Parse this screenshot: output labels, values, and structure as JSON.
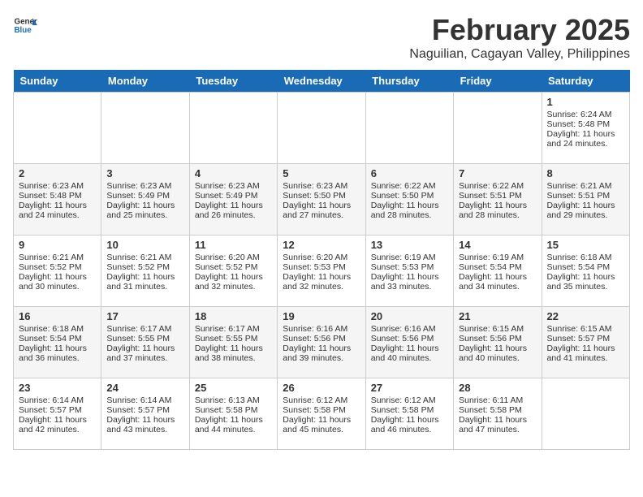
{
  "header": {
    "logo_general": "General",
    "logo_blue": "Blue",
    "month": "February 2025",
    "location": "Naguilian, Cagayan Valley, Philippines"
  },
  "weekdays": [
    "Sunday",
    "Monday",
    "Tuesday",
    "Wednesday",
    "Thursday",
    "Friday",
    "Saturday"
  ],
  "weeks": [
    [
      {
        "day": "",
        "info": ""
      },
      {
        "day": "",
        "info": ""
      },
      {
        "day": "",
        "info": ""
      },
      {
        "day": "",
        "info": ""
      },
      {
        "day": "",
        "info": ""
      },
      {
        "day": "",
        "info": ""
      },
      {
        "day": "1",
        "info": "Sunrise: 6:24 AM\nSunset: 5:48 PM\nDaylight: 11 hours and 24 minutes."
      }
    ],
    [
      {
        "day": "2",
        "info": "Sunrise: 6:23 AM\nSunset: 5:48 PM\nDaylight: 11 hours and 24 minutes."
      },
      {
        "day": "3",
        "info": "Sunrise: 6:23 AM\nSunset: 5:49 PM\nDaylight: 11 hours and 25 minutes."
      },
      {
        "day": "4",
        "info": "Sunrise: 6:23 AM\nSunset: 5:49 PM\nDaylight: 11 hours and 26 minutes."
      },
      {
        "day": "5",
        "info": "Sunrise: 6:23 AM\nSunset: 5:50 PM\nDaylight: 11 hours and 27 minutes."
      },
      {
        "day": "6",
        "info": "Sunrise: 6:22 AM\nSunset: 5:50 PM\nDaylight: 11 hours and 28 minutes."
      },
      {
        "day": "7",
        "info": "Sunrise: 6:22 AM\nSunset: 5:51 PM\nDaylight: 11 hours and 28 minutes."
      },
      {
        "day": "8",
        "info": "Sunrise: 6:21 AM\nSunset: 5:51 PM\nDaylight: 11 hours and 29 minutes."
      }
    ],
    [
      {
        "day": "9",
        "info": "Sunrise: 6:21 AM\nSunset: 5:52 PM\nDaylight: 11 hours and 30 minutes."
      },
      {
        "day": "10",
        "info": "Sunrise: 6:21 AM\nSunset: 5:52 PM\nDaylight: 11 hours and 31 minutes."
      },
      {
        "day": "11",
        "info": "Sunrise: 6:20 AM\nSunset: 5:52 PM\nDaylight: 11 hours and 32 minutes."
      },
      {
        "day": "12",
        "info": "Sunrise: 6:20 AM\nSunset: 5:53 PM\nDaylight: 11 hours and 32 minutes."
      },
      {
        "day": "13",
        "info": "Sunrise: 6:19 AM\nSunset: 5:53 PM\nDaylight: 11 hours and 33 minutes."
      },
      {
        "day": "14",
        "info": "Sunrise: 6:19 AM\nSunset: 5:54 PM\nDaylight: 11 hours and 34 minutes."
      },
      {
        "day": "15",
        "info": "Sunrise: 6:18 AM\nSunset: 5:54 PM\nDaylight: 11 hours and 35 minutes."
      }
    ],
    [
      {
        "day": "16",
        "info": "Sunrise: 6:18 AM\nSunset: 5:54 PM\nDaylight: 11 hours and 36 minutes."
      },
      {
        "day": "17",
        "info": "Sunrise: 6:17 AM\nSunset: 5:55 PM\nDaylight: 11 hours and 37 minutes."
      },
      {
        "day": "18",
        "info": "Sunrise: 6:17 AM\nSunset: 5:55 PM\nDaylight: 11 hours and 38 minutes."
      },
      {
        "day": "19",
        "info": "Sunrise: 6:16 AM\nSunset: 5:56 PM\nDaylight: 11 hours and 39 minutes."
      },
      {
        "day": "20",
        "info": "Sunrise: 6:16 AM\nSunset: 5:56 PM\nDaylight: 11 hours and 40 minutes."
      },
      {
        "day": "21",
        "info": "Sunrise: 6:15 AM\nSunset: 5:56 PM\nDaylight: 11 hours and 40 minutes."
      },
      {
        "day": "22",
        "info": "Sunrise: 6:15 AM\nSunset: 5:57 PM\nDaylight: 11 hours and 41 minutes."
      }
    ],
    [
      {
        "day": "23",
        "info": "Sunrise: 6:14 AM\nSunset: 5:57 PM\nDaylight: 11 hours and 42 minutes."
      },
      {
        "day": "24",
        "info": "Sunrise: 6:14 AM\nSunset: 5:57 PM\nDaylight: 11 hours and 43 minutes."
      },
      {
        "day": "25",
        "info": "Sunrise: 6:13 AM\nSunset: 5:58 PM\nDaylight: 11 hours and 44 minutes."
      },
      {
        "day": "26",
        "info": "Sunrise: 6:12 AM\nSunset: 5:58 PM\nDaylight: 11 hours and 45 minutes."
      },
      {
        "day": "27",
        "info": "Sunrise: 6:12 AM\nSunset: 5:58 PM\nDaylight: 11 hours and 46 minutes."
      },
      {
        "day": "28",
        "info": "Sunrise: 6:11 AM\nSunset: 5:58 PM\nDaylight: 11 hours and 47 minutes."
      },
      {
        "day": "",
        "info": ""
      }
    ]
  ]
}
